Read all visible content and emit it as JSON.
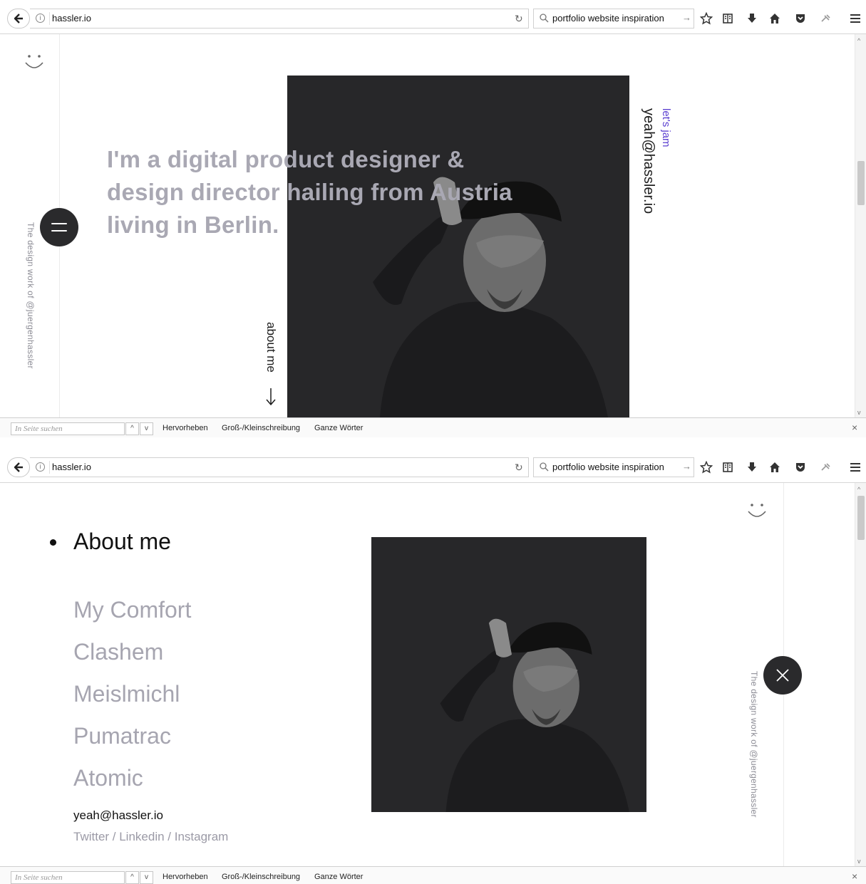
{
  "browser": {
    "url": "hassler.io",
    "search_text": "portfolio website inspiration",
    "icons": [
      "back-arrow-icon",
      "info-icon",
      "reload-icon",
      "search-icon",
      "go-arrow-icon",
      "bookmark-star-icon",
      "reading-list-icon",
      "download-icon",
      "home-icon",
      "pocket-icon",
      "extension-icon",
      "hamburger-menu-icon"
    ]
  },
  "findbar": {
    "placeholder": "In Seite suchen",
    "prev": "^",
    "next": "v",
    "highlight": "Hervorheben",
    "match_case": "Groß-/Kleinschreibung",
    "whole_words": "Ganze Wörter",
    "close": "×"
  },
  "screen1": {
    "headline": "I'm a digital product designer & design director hailing from Austria living in Berlin.",
    "tagline_vertical": "The design work of @juergenhassler",
    "lets_jam": "let's jam",
    "email": "yeah@hassler.io",
    "about_link": "about me",
    "scroll_position": 0.33
  },
  "screen2": {
    "active_item": "About me",
    "nav_items": [
      "My Comfort",
      "Clashem",
      "Meislmichl",
      "Pumatrac",
      "Atomic"
    ],
    "email": "yeah@hassler.io",
    "social": "Twitter / Linkedin / Instagram",
    "tagline_vertical": "The design work of @juergenhassler",
    "scroll_position": 0.02
  },
  "colors": {
    "accent_purple": "#5b3fd0",
    "headline_gray": "#a9a8b3",
    "dark_button": "#2a2a2c",
    "photo_bg": "#272729"
  }
}
